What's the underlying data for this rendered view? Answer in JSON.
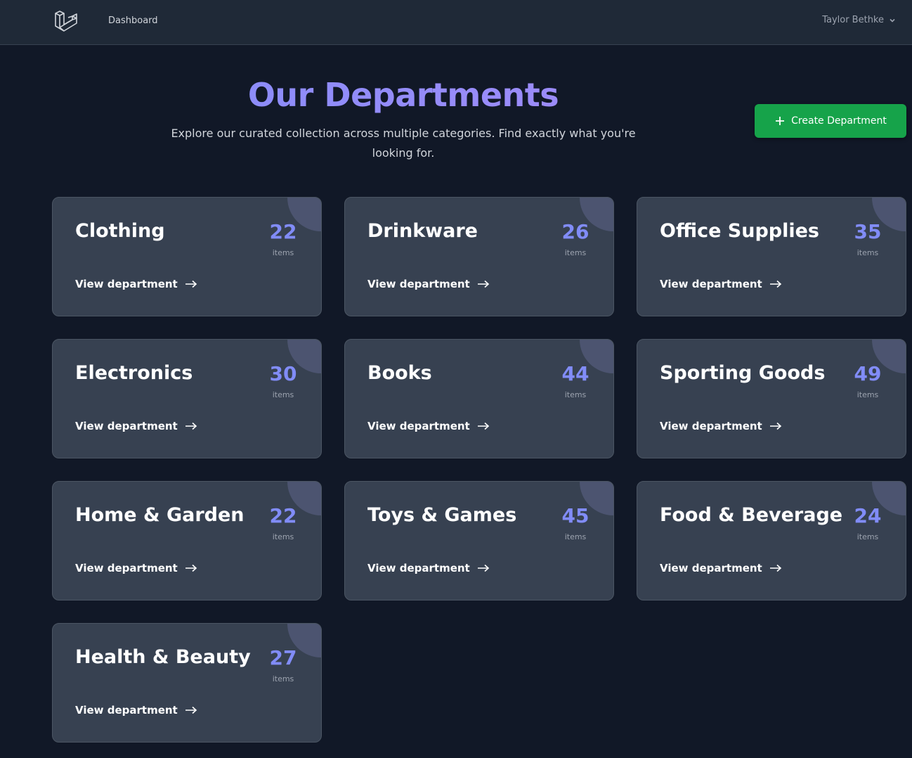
{
  "nav": {
    "logo_icon": "laravel-logo",
    "dashboard_label": "Dashboard",
    "user_name": "Taylor Bethke"
  },
  "header": {
    "title": "Our Departments",
    "subtitle": "Explore our curated collection across multiple categories. Find exactly what you're looking for.",
    "create_button_label": "Create Department"
  },
  "colors": {
    "background": "#111827",
    "nav_background": "#1f2937",
    "card_background": "#374151",
    "accent": "#818cf8",
    "create_button": "#16a34a"
  },
  "departments": [
    {
      "name": "Clothing",
      "count": "22",
      "count_label": "items",
      "link_label": "View department"
    },
    {
      "name": "Drinkware",
      "count": "26",
      "count_label": "items",
      "link_label": "View department"
    },
    {
      "name": "Office Supplies",
      "count": "35",
      "count_label": "items",
      "link_label": "View department"
    },
    {
      "name": "Electronics",
      "count": "30",
      "count_label": "items",
      "link_label": "View department"
    },
    {
      "name": "Books",
      "count": "44",
      "count_label": "items",
      "link_label": "View department"
    },
    {
      "name": "Sporting Goods",
      "count": "49",
      "count_label": "items",
      "link_label": "View department"
    },
    {
      "name": "Home & Garden",
      "count": "22",
      "count_label": "items",
      "link_label": "View department"
    },
    {
      "name": "Toys & Games",
      "count": "45",
      "count_label": "items",
      "link_label": "View department"
    },
    {
      "name": "Food & Beverage",
      "count": "24",
      "count_label": "items",
      "link_label": "View department"
    },
    {
      "name": "Health & Beauty",
      "count": "27",
      "count_label": "items",
      "link_label": "View department"
    }
  ]
}
